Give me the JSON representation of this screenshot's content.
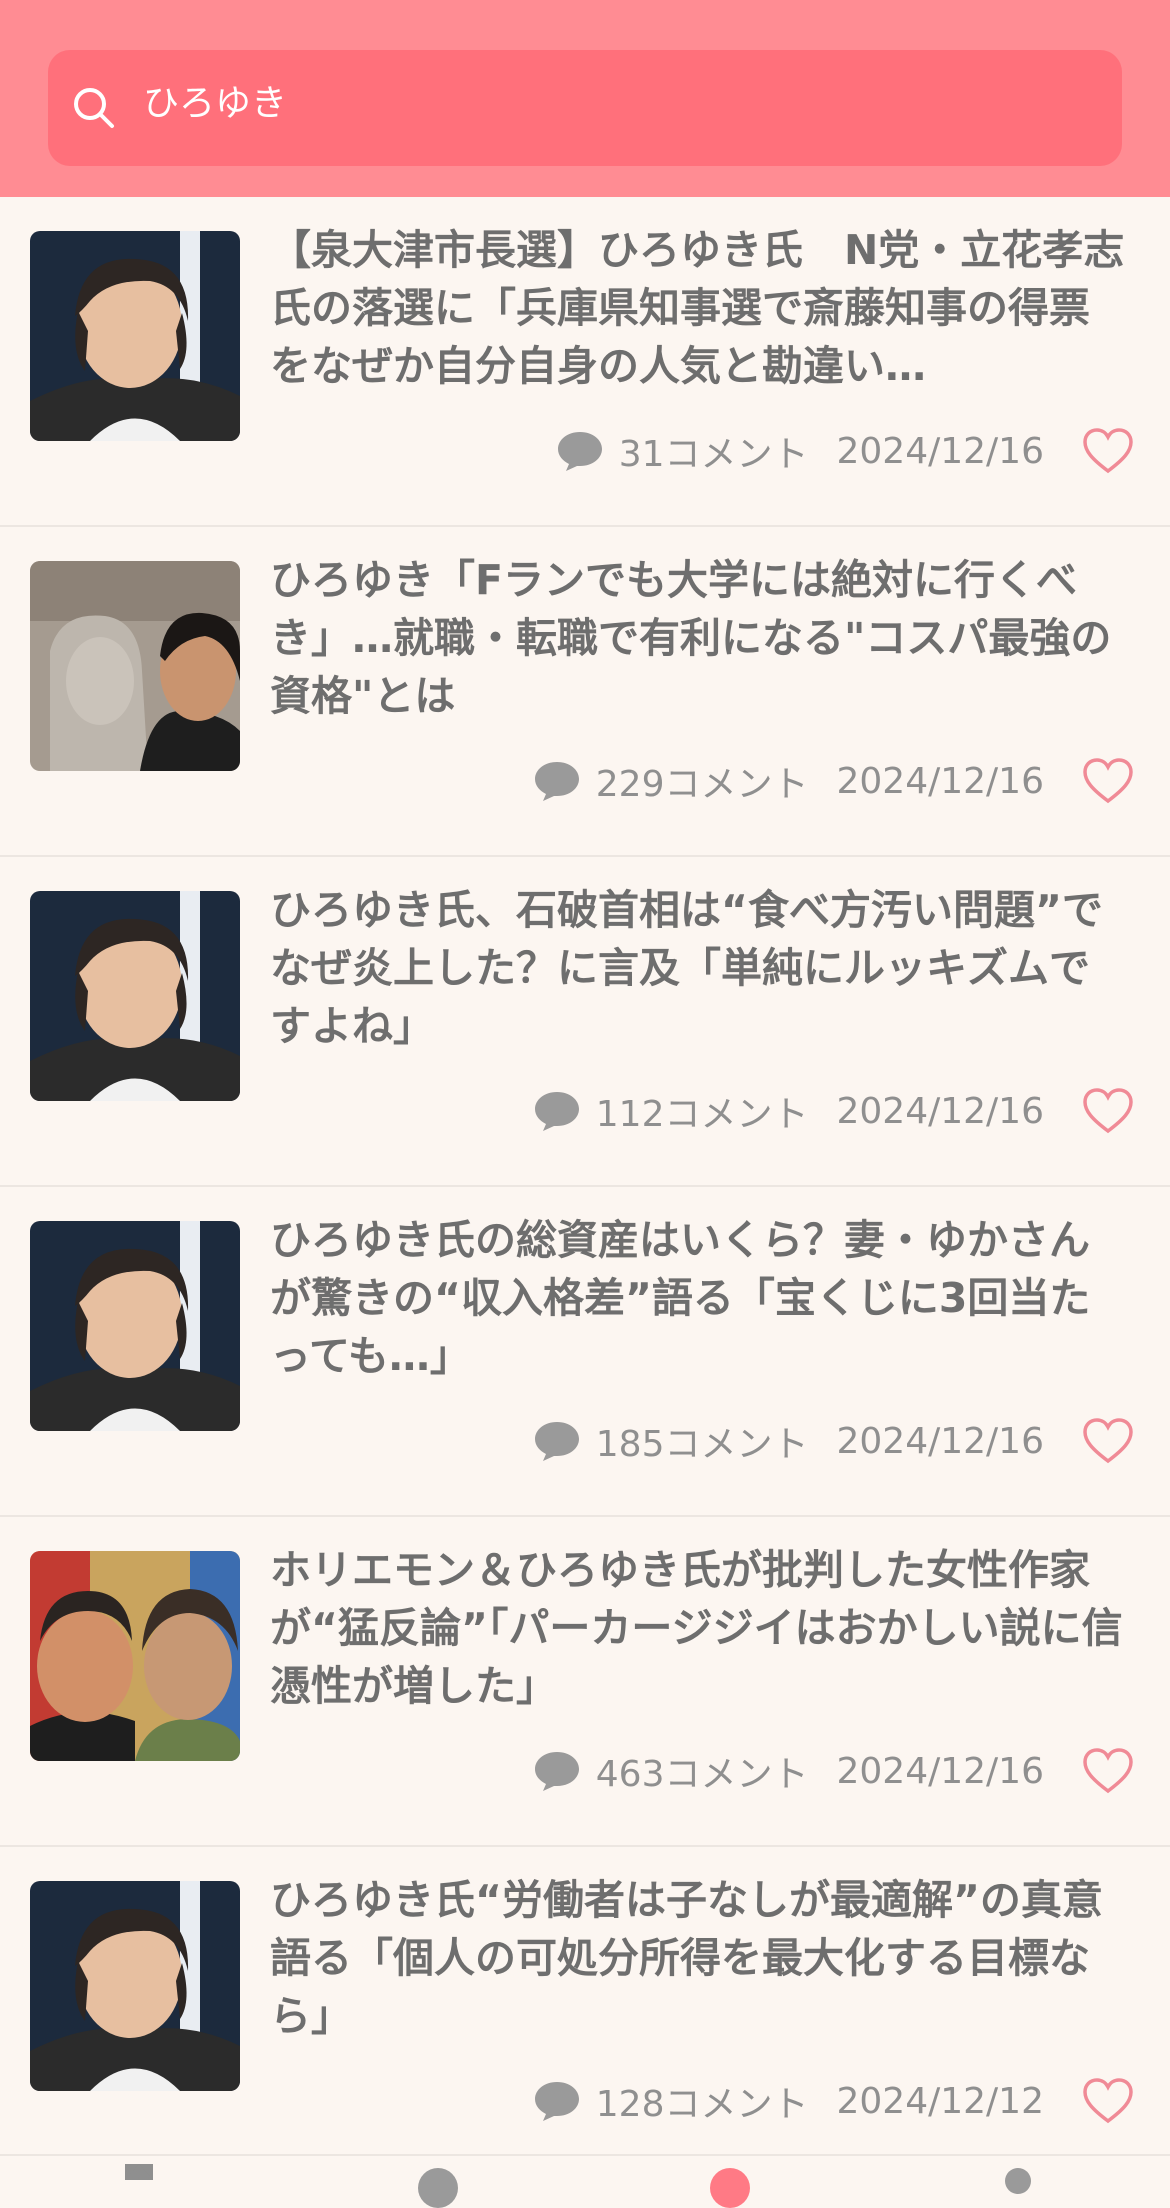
{
  "search": {
    "query": "ひろゆき",
    "icon": "search-icon"
  },
  "comment_suffix": "コメント",
  "articles": [
    {
      "title": "【泉大津市長選】ひろゆき氏　N党・立花孝志氏の落選に「兵庫県知事選で斎藤知事の得票をなぜか自分自身の人気と勘違い…",
      "comments": "31",
      "comment_label": "31コメント",
      "date": "2024/12/16",
      "thumb": "portrait-dark"
    },
    {
      "title": "ひろゆき「Fランでも大学には絶対に行くべき」…就職・転職で有利になる\"コスパ最強の資格\"とは",
      "comments": "229",
      "comment_label": "229コメント",
      "date": "2024/12/16",
      "thumb": "statue"
    },
    {
      "title": "ひろゆき氏、石破首相は“食べ方汚い問題”でなぜ炎上した？に言及「単純にルッキズムですよね」",
      "comments": "112",
      "comment_label": "112コメント",
      "date": "2024/12/16",
      "thumb": "portrait-dark"
    },
    {
      "title": "ひろゆき氏の総資産はいくら？妻・ゆかさんが驚きの“収入格差”語る「宝くじに3回当たっても…」",
      "comments": "185",
      "comment_label": "185コメント",
      "date": "2024/12/16",
      "thumb": "portrait-dark"
    },
    {
      "title": "ホリエモン＆ひろゆき氏が批判した女性作家が“猛反論”「パーカージジイはおかしい説に信憑性が増した」",
      "comments": "463",
      "comment_label": "463コメント",
      "date": "2024/12/16",
      "thumb": "two-people"
    },
    {
      "title": "ひろゆき氏“労働者は子なしが最適解”の真意語る「個人の可処分所得を最大化する目標なら」",
      "comments": "128",
      "comment_label": "128コメント",
      "date": "2024/12/12",
      "thumb": "portrait-dark"
    }
  ],
  "colors": {
    "header": "#ff8c93",
    "search_bg": "#ff707b",
    "background": "#fcf6f1",
    "heart": "#f08a96",
    "text": "#6e6e6e"
  }
}
